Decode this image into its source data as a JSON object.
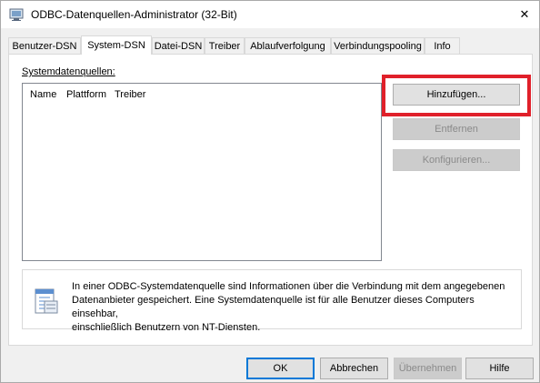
{
  "window": {
    "title": "ODBC-Datenquellen-Administrator (32-Bit)",
    "close_glyph": "✕"
  },
  "tabs": [
    {
      "label": "Benutzer-DSN"
    },
    {
      "label": "System-DSN",
      "active": true
    },
    {
      "label": "Datei-DSN"
    },
    {
      "label": "Treiber"
    },
    {
      "label": "Ablaufverfolgung"
    },
    {
      "label": "Verbindungspooling"
    },
    {
      "label": "Info"
    }
  ],
  "system_dsn": {
    "group_label": "Systemdatenquellen:",
    "columns": [
      "Name",
      "Plattform",
      "Treiber"
    ],
    "rows": []
  },
  "buttons": {
    "add": "Hinzufügen...",
    "remove": "Entfernen",
    "configure": "Konfigurieren..."
  },
  "info": {
    "text_line1": "In einer ODBC-Systemdatenquelle sind Informationen über die Verbindung mit dem angegebenen",
    "text_line2": "Datenanbieter gespeichert. Eine Systemdatenquelle ist für alle Benutzer dieses Computers einsehbar,",
    "text_line3": "einschließlich Benutzern von NT-Diensten."
  },
  "footer": {
    "ok": "OK",
    "cancel": "Abbrechen",
    "apply": "Übernehmen",
    "help": "Hilfe"
  },
  "colors": {
    "highlight": "#e0202a",
    "accent": "#0078d7"
  }
}
